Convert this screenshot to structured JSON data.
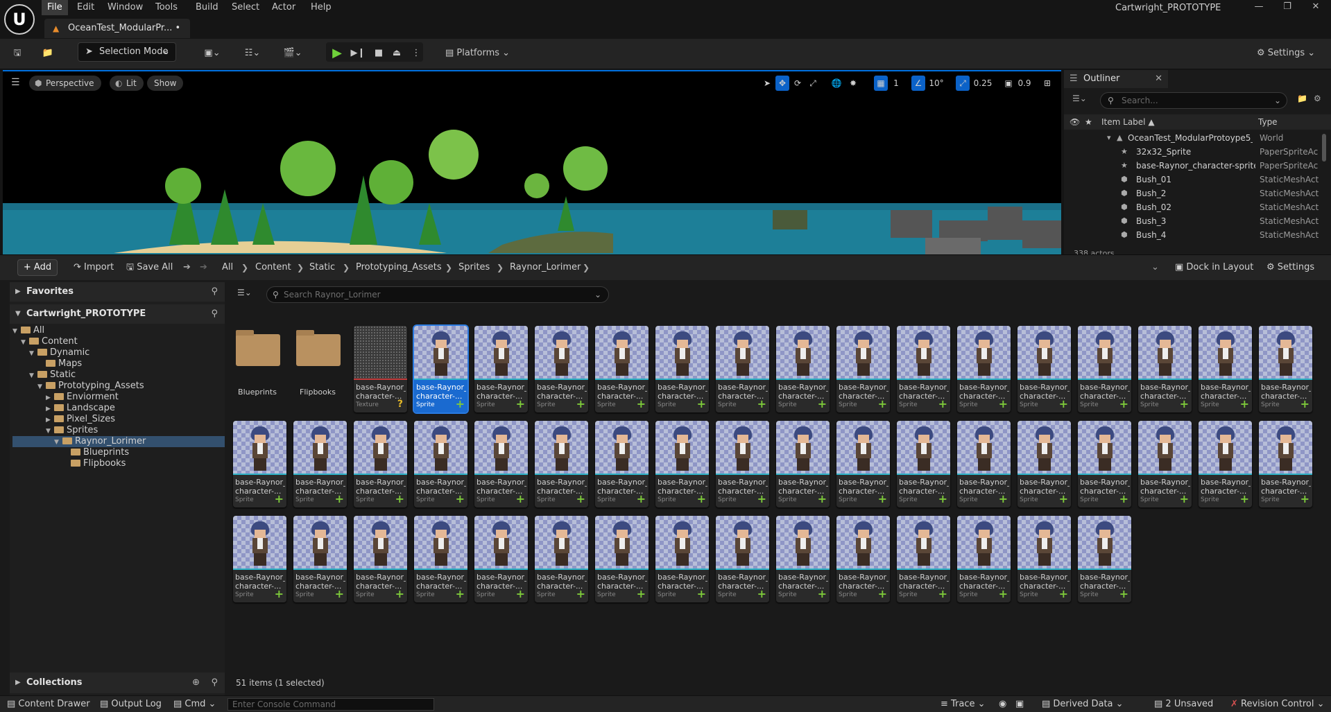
{
  "app": {
    "logo": "U",
    "project": "Cartwright_PROTOTYPE",
    "doc_tab": "OceanTest_ModularPr...  •"
  },
  "menu": [
    "File",
    "Edit",
    "Window",
    "Tools",
    "Build",
    "Select",
    "Actor",
    "Help"
  ],
  "toolbar": {
    "selection_mode": "Selection Mode",
    "platforms": "Platforms",
    "settings": "Settings"
  },
  "viewport": {
    "perspective": "Perspective",
    "lit": "Lit",
    "show": "Show",
    "grid_value": "1",
    "rotation_snap": "10°",
    "scale_snap": "0.25",
    "camera_speed": "0.9"
  },
  "outliner": {
    "title": "Outliner",
    "search_placeholder": "Search...",
    "col_label": "Item Label ▲",
    "col_type": "Type",
    "rows": [
      {
        "label": "OceanTest_ModularProtoype5_:",
        "type": "World"
      },
      {
        "label": "32x32_Sprite",
        "type": "PaperSpriteAc"
      },
      {
        "label": "base-Raynor_character-sprite",
        "type": "PaperSpriteAc"
      },
      {
        "label": "Bush_01",
        "type": "StaticMeshAct"
      },
      {
        "label": "Bush_2",
        "type": "StaticMeshAct"
      },
      {
        "label": "Bush_02",
        "type": "StaticMeshAct"
      },
      {
        "label": "Bush_3",
        "type": "StaticMeshAct"
      },
      {
        "label": "Bush_4",
        "type": "StaticMeshAct"
      }
    ],
    "actors_count": "338 actors"
  },
  "content_browser": {
    "add": "Add",
    "import": "Import",
    "save_all": "Save All",
    "breadcrumb": [
      "All",
      "Content",
      "Static",
      "Prototyping_Assets",
      "Sprites",
      "Raynor_Lorimer"
    ],
    "dock": "Dock in Layout",
    "settings": "Settings",
    "favorites": "Favorites",
    "project": "Cartwright_PROTOTYPE",
    "collections": "Collections",
    "tree": [
      {
        "label": "All",
        "depth": 0
      },
      {
        "label": "Content",
        "depth": 1
      },
      {
        "label": "Dynamic",
        "depth": 2
      },
      {
        "label": "Maps",
        "depth": 3
      },
      {
        "label": "Static",
        "depth": 2
      },
      {
        "label": "Prototyping_Assets",
        "depth": 3
      },
      {
        "label": "Enviorment",
        "depth": 4
      },
      {
        "label": "Landscape",
        "depth": 4
      },
      {
        "label": "Pixel_Sizes",
        "depth": 4
      },
      {
        "label": "Sprites",
        "depth": 4
      },
      {
        "label": "Raynor_Lorimer",
        "depth": 5
      },
      {
        "label": "Blueprints",
        "depth": 6
      },
      {
        "label": "Flipbooks",
        "depth": 6
      }
    ],
    "search_placeholder": "Search Raynor_Lorimer",
    "folders": [
      "Blueprints",
      "Flipbooks"
    ],
    "asset_name_line1": "base-Raynor_",
    "asset_name_line2": "character-...",
    "texture_name_line2": "character-...",
    "kind_texture": "Texture",
    "kind_sprite": "Sprite",
    "items_count": "51 items (1 selected)"
  },
  "statusbar": {
    "content_drawer": "Content Drawer",
    "output_log": "Output Log",
    "cmd": "Cmd",
    "console_placeholder": "Enter Console Command",
    "trace": "Trace",
    "derived_data": "Derived Data",
    "unsaved": "2 Unsaved",
    "revision": "Revision Control"
  }
}
